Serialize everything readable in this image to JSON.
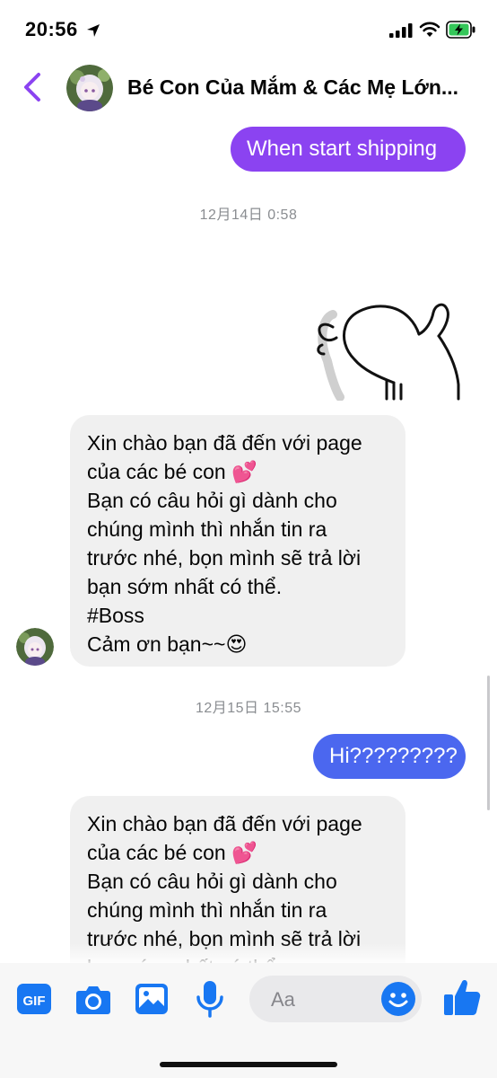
{
  "status_bar": {
    "time": "20:56"
  },
  "header": {
    "title": "Bé Con Của Mắm & Các Mẹ Lớn..."
  },
  "messages": {
    "m1": {
      "text": "When start shipping",
      "color": "#8b43f1"
    },
    "ts1": "12月14日 0:58",
    "m2": {
      "text": "Xin chào bạn đã đến với page\ncủa các bé con 💕\nBạn có câu hỏi gì dành cho\nchúng mình thì nhắn tin ra\ntrước nhé, bọn mình sẽ trả lời\nbạn sớm nhất có thể.\n#Boss\nCảm ơn bạn~~😍"
    },
    "ts2": "12月15日 15:55",
    "m3": {
      "text": "Hi?????????",
      "color": "#4b67ef"
    },
    "m4": {
      "text": "Xin chào bạn đã đến với page\ncủa các bé con 💕\nBạn có câu hỏi gì dành cho\nchúng mình thì nhắn tin ra\ntrước nhé, bọn mình sẽ trả lời\nbạn sớm nhất có thể."
    }
  },
  "composer": {
    "placeholder": "Aa",
    "gif_label": "GIF",
    "icons": [
      "gif-icon",
      "camera-icon",
      "photo-icon",
      "microphone-icon",
      "emoji-icon",
      "thumbs-up-icon"
    ],
    "accent": "#1877f2"
  }
}
